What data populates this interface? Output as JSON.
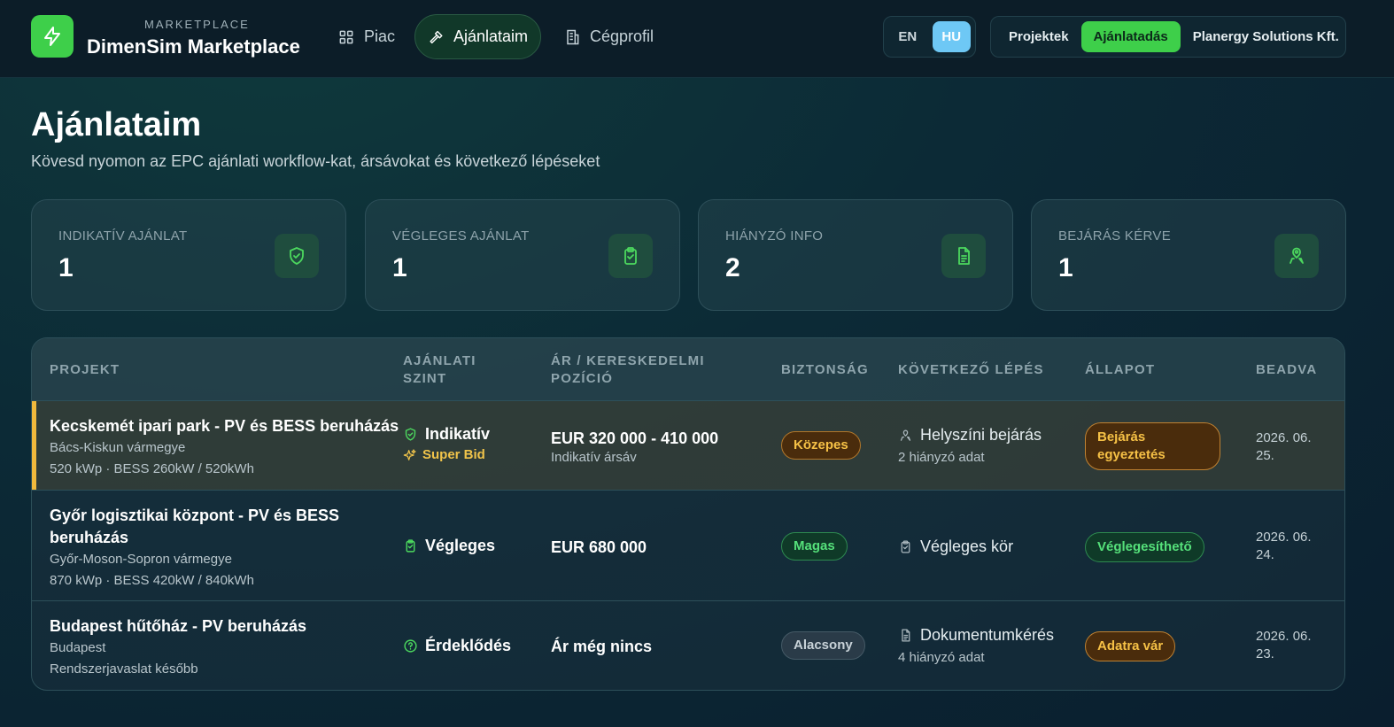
{
  "brand": {
    "subtitle": "MARKETPLACE",
    "title": "DimenSim Marketplace"
  },
  "nav": [
    {
      "label": "Piac",
      "icon": "grid-icon"
    },
    {
      "label": "Ajánlataim",
      "icon": "hammer-icon"
    },
    {
      "label": "Cégprofil",
      "icon": "building-icon"
    }
  ],
  "lang": {
    "en": "EN",
    "hu": "HU",
    "active": "HU"
  },
  "modes": {
    "projects": "Projektek",
    "bidding": "Ajánlatadás",
    "company": "Planergy Solutions Kft."
  },
  "page": {
    "title": "Ajánlataim",
    "subtitle": "Kövesd nyomon az EPC ajánlati workflow-kat, ársávokat és következő lépéseket"
  },
  "stats": [
    {
      "label": "Indikatív ajánlat",
      "value": "1",
      "icon": "shield-check-icon"
    },
    {
      "label": "Végleges ajánlat",
      "value": "1",
      "icon": "clipboard-check-icon"
    },
    {
      "label": "Hiányzó info",
      "value": "2",
      "icon": "document-icon"
    },
    {
      "label": "Bejárás kérve",
      "value": "1",
      "icon": "map-pin-user-icon"
    }
  ],
  "table": {
    "headers": {
      "project": "Projekt",
      "level": "Ajánlati szint",
      "price": "Ár / kereskedelmi pozíció",
      "security": "Biztonság",
      "next": "Következő lépés",
      "status": "Állapot",
      "submitted": "Beadva"
    },
    "rows": [
      {
        "title": "Kecskemét ipari park - PV és BESS beruházás",
        "region": "Bács-Kiskun vármegye",
        "specs": "520 kWp · BESS 260kW / 520kWh",
        "level": "Indikatív",
        "level_icon": "shield-check-icon",
        "badge": "Super Bid",
        "price": "EUR 320 000 - 410 000",
        "price_note": "Indikatív ársáv",
        "security": "Közepes",
        "next": "Helyszíni bejárás",
        "next_icon": "user-pin-icon",
        "next_note": "2 hiányzó adat",
        "status": "Bejárás egyeztetés",
        "date": "2026. 06. 25."
      },
      {
        "title": "Győr logisztikai központ - PV és BESS beruházás",
        "region": "Győr-Moson-Sopron vármegye",
        "specs": "870 kWp · BESS 420kW / 840kWh",
        "level": "Végleges",
        "level_icon": "clipboard-check-icon",
        "price": "EUR 680 000",
        "security": "Magas",
        "next": "Végleges kör",
        "next_icon": "clipboard-icon",
        "status": "Véglegesíthető",
        "date": "2026. 06. 24."
      },
      {
        "title": "Budapest hűtőház - PV beruházás",
        "region": "Budapest",
        "specs": "Rendszerjavaslat később",
        "level": "Érdeklődés",
        "level_icon": "question-circle-icon",
        "price": "Ár még nincs",
        "security": "Alacsony",
        "next": "Dokumentumkérés",
        "next_icon": "document-icon",
        "next_note": "4 hiányzó adat",
        "status": "Adatra vár",
        "date": "2026. 06. 23."
      }
    ]
  },
  "colors": {
    "accent": "#3ecf4a",
    "lang_active": "#6ec8f5",
    "warning": "#f6c146",
    "success": "#55e07a"
  }
}
